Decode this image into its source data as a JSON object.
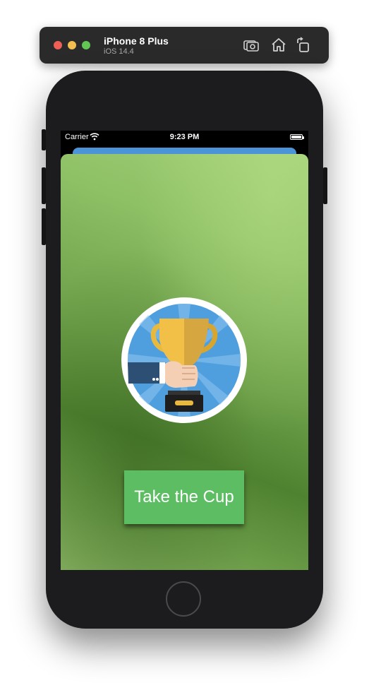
{
  "simulator": {
    "device_name": "iPhone 8 Plus",
    "os_version": "iOS 14.4",
    "icons": [
      "screenshot-icon",
      "home-icon",
      "rotate-icon"
    ]
  },
  "status_bar": {
    "carrier": "Carrier",
    "time": "9:23 PM"
  },
  "main": {
    "image": "trophy-in-hand-icon",
    "button_label": "Take the Cup"
  },
  "colors": {
    "button": "#5cbd62",
    "background_light": "#a1cf77",
    "background_dark": "#4f8230",
    "badge_blue": "#4f9fdf",
    "sheet_behind": "#4b94d8"
  }
}
